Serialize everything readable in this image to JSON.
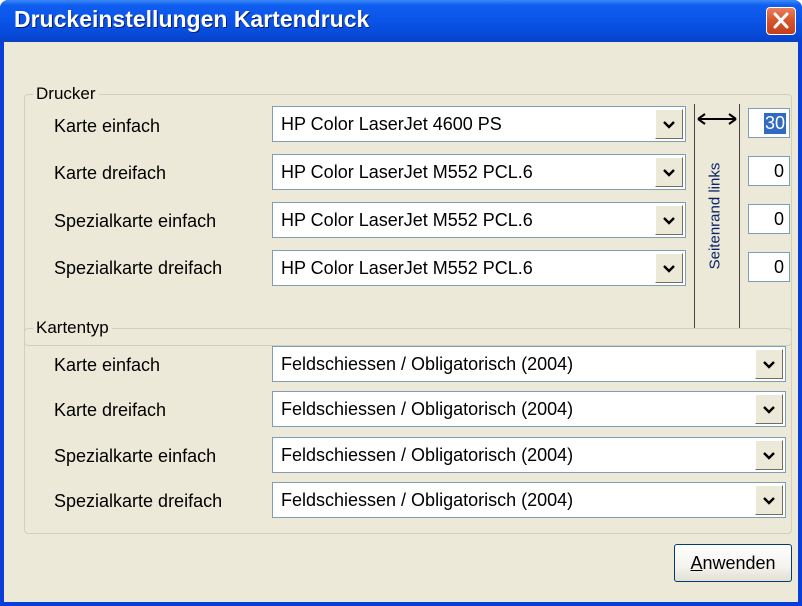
{
  "window": {
    "title": "Druckeinstellungen Kartendruck"
  },
  "drucker": {
    "group_label": "Drucker",
    "rows": [
      {
        "label": "Karte einfach",
        "value": "HP Color LaserJet 4600 PS",
        "margin": "30"
      },
      {
        "label": "Karte dreifach",
        "value": "HP Color LaserJet M552 PCL.6",
        "margin": "0"
      },
      {
        "label": "Spezialkarte einfach",
        "value": "HP Color LaserJet M552 PCL.6",
        "margin": "0"
      },
      {
        "label": "Spezialkarte dreifach",
        "value": "HP Color LaserJet M552 PCL.6",
        "margin": "0"
      }
    ],
    "margin_label": "Seitenrand links"
  },
  "kartentyp": {
    "group_label": "Kartentyp",
    "rows": [
      {
        "label": "Karte einfach",
        "value": "Feldschiessen / Obligatorisch (2004)"
      },
      {
        "label": "Karte dreifach",
        "value": "Feldschiessen / Obligatorisch (2004)"
      },
      {
        "label": "Spezialkarte einfach",
        "value": "Feldschiessen / Obligatorisch (2004)"
      },
      {
        "label": "Spezialkarte dreifach",
        "value": "Feldschiessen / Obligatorisch (2004)"
      }
    ]
  },
  "footer": {
    "apply_label_accel": "A",
    "apply_label_rest": "nwenden"
  }
}
